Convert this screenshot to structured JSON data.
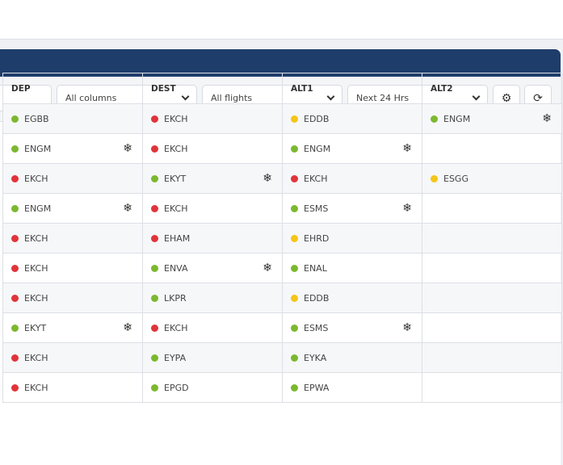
{
  "toolbar": {
    "columns_select": "All columns",
    "flights_select": "All flights",
    "time_select": "Next 24 Hrs",
    "filter_icon": "sliders-icon",
    "refresh_icon": "refresh-icon"
  },
  "headers": [
    "DEP",
    "DEST",
    "ALT1",
    "ALT2"
  ],
  "status_colors": {
    "green": "#7cb82f",
    "red": "#e0343a",
    "yellow": "#f5c518"
  },
  "rows": [
    [
      {
        "code": "EGBB",
        "status": "green"
      },
      {
        "code": "EKCH",
        "status": "red"
      },
      {
        "code": "EDDB",
        "status": "yellow"
      },
      {
        "code": "ENGM",
        "status": "green",
        "snow": true
      }
    ],
    [
      {
        "code": "ENGM",
        "status": "green",
        "snow": true
      },
      {
        "code": "EKCH",
        "status": "red"
      },
      {
        "code": "ENGM",
        "status": "green",
        "snow": true
      },
      null
    ],
    [
      {
        "code": "EKCH",
        "status": "red"
      },
      {
        "code": "EKYT",
        "status": "green",
        "snow": true
      },
      {
        "code": "EKCH",
        "status": "red"
      },
      {
        "code": "ESGG",
        "status": "yellow"
      }
    ],
    [
      {
        "code": "ENGM",
        "status": "green",
        "snow": true
      },
      {
        "code": "EKCH",
        "status": "red"
      },
      {
        "code": "ESMS",
        "status": "green",
        "snow": true
      },
      null
    ],
    [
      {
        "code": "EKCH",
        "status": "red"
      },
      {
        "code": "EHAM",
        "status": "red"
      },
      {
        "code": "EHRD",
        "status": "yellow"
      },
      null
    ],
    [
      {
        "code": "EKCH",
        "status": "red"
      },
      {
        "code": "ENVA",
        "status": "green",
        "snow": true
      },
      {
        "code": "ENAL",
        "status": "green"
      },
      null
    ],
    [
      {
        "code": "EKCH",
        "status": "red"
      },
      {
        "code": "LKPR",
        "status": "green"
      },
      {
        "code": "EDDB",
        "status": "yellow"
      },
      null
    ],
    [
      {
        "code": "EKYT",
        "status": "green",
        "snow": true
      },
      {
        "code": "EKCH",
        "status": "red"
      },
      {
        "code": "ESMS",
        "status": "green",
        "snow": true
      },
      null
    ],
    [
      {
        "code": "EKCH",
        "status": "red"
      },
      {
        "code": "EYPA",
        "status": "green"
      },
      {
        "code": "EYKA",
        "status": "green"
      },
      null
    ],
    [
      {
        "code": "EKCH",
        "status": "red"
      },
      {
        "code": "EPGD",
        "status": "green"
      },
      {
        "code": "EPWA",
        "status": "green"
      },
      null
    ]
  ]
}
